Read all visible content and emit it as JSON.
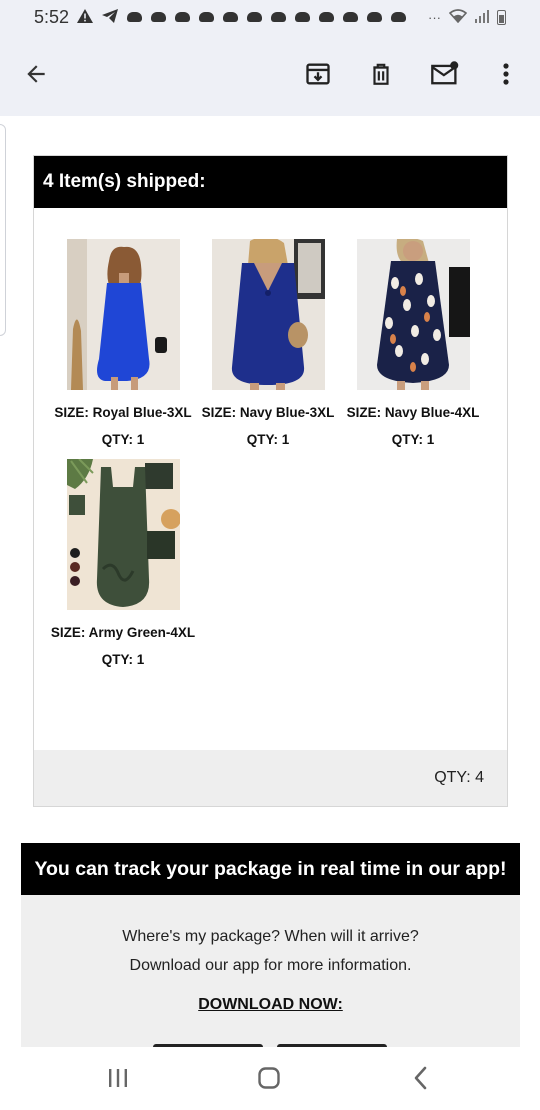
{
  "status_bar": {
    "time": "5:52",
    "dots": "···"
  },
  "app_bar": {
    "icons": [
      "back-arrow-icon",
      "archive-icon",
      "delete-icon",
      "mark-unread-icon",
      "more-vert-icon"
    ]
  },
  "shipment": {
    "header": "4 Item(s) shipped:",
    "items": [
      {
        "size": "SIZE: Royal Blue-3XL",
        "qty": "QTY: 1",
        "color": "#1f46d6"
      },
      {
        "size": "SIZE: Navy Blue-3XL",
        "qty": "QTY: 1",
        "color": "#1e2f8c"
      },
      {
        "size": "SIZE: Navy Blue-4XL",
        "qty": "QTY: 1",
        "color": "#1a2248"
      },
      {
        "size": "SIZE: Army Green-4XL",
        "qty": "QTY: 1",
        "color": "#3e4f3a"
      }
    ],
    "total_qty": "QTY: 4"
  },
  "track": {
    "header": "You can track your package in real time in our app!",
    "line1": "Where's my package? When will it arrive?",
    "line2": "Download our app for more information.",
    "download": "DOWNLOAD NOW:"
  },
  "nav_bar": {
    "icons": [
      "recents-icon",
      "home-icon",
      "back-icon"
    ]
  }
}
